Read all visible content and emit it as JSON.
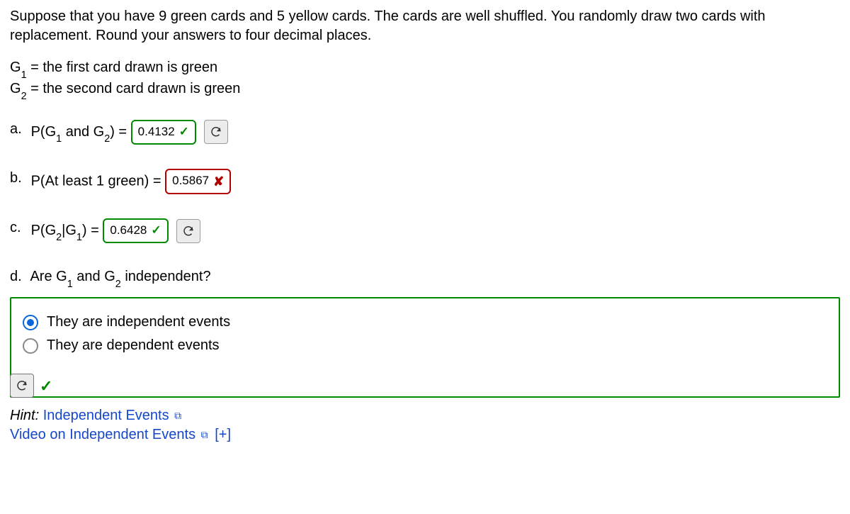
{
  "intro": "Suppose that you have 9 green cards and 5 yellow cards. The cards are well shuffled. You randomly draw two cards with replacement. Round your answers to four decimal places.",
  "defs": {
    "g1": "the first card drawn is green",
    "g2": "the second card drawn is green"
  },
  "questions": {
    "a": {
      "label": "a.",
      "prefix": "P(G",
      "s1": "1",
      "mid": " and G",
      "s2": "2",
      "suffix": ") = ",
      "value": "0.4132",
      "state": "correct",
      "mark": "✓"
    },
    "b": {
      "label": "b.",
      "text": "P(At least 1 green) =",
      "value": "0.5867",
      "state": "incorrect",
      "mark": "✘"
    },
    "c": {
      "label": "c.",
      "prefix": "P(G",
      "s1": "2",
      "mid": "|G",
      "s2": "1",
      "suffix": ") = ",
      "value": "0.6428",
      "state": "correct",
      "mark": "✓"
    },
    "d": {
      "label": "d.",
      "prefix": "Are G",
      "s1": "1",
      "mid": " and G",
      "s2": "2",
      "suffix": " independent?",
      "opt1": "They are independent events",
      "opt2": "They are dependent events",
      "mark": "✓"
    }
  },
  "hint": {
    "label": "Hint:",
    "link1": "Independent Events",
    "link2": "Video on Independent Events",
    "plus": "[+]"
  }
}
